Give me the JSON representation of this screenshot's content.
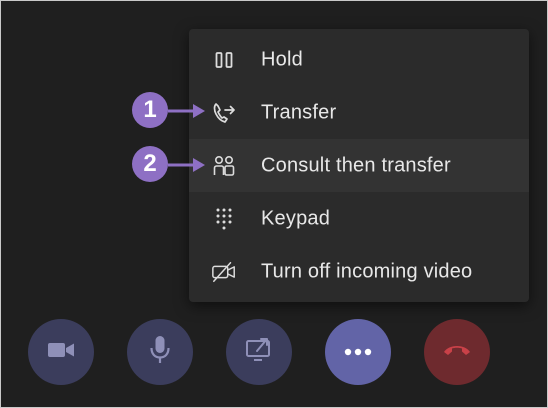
{
  "menu": {
    "items": [
      {
        "label": "Hold",
        "icon": "pause-icon"
      },
      {
        "label": "Transfer",
        "icon": "phone-transfer-icon"
      },
      {
        "label": "Consult then transfer",
        "icon": "consult-people-icon"
      },
      {
        "label": "Keypad",
        "icon": "dialpad-icon"
      },
      {
        "label": "Turn off incoming video",
        "icon": "video-off-icon"
      }
    ]
  },
  "callouts": [
    {
      "number": "1",
      "target": "Transfer"
    },
    {
      "number": "2",
      "target": "Consult then transfer"
    }
  ],
  "controls": [
    {
      "icon": "camera-icon"
    },
    {
      "icon": "microphone-icon"
    },
    {
      "icon": "share-screen-icon"
    },
    {
      "icon": "more-options-icon"
    },
    {
      "icon": "hang-up-icon"
    }
  ],
  "colors": {
    "background": "#1f1f1f",
    "menu": "#2b2b2b",
    "callout": "#8e70c4",
    "more_button": "#6264a7",
    "hangup_button": "#6e2a2e",
    "dim_button": "#3b3d5c"
  }
}
